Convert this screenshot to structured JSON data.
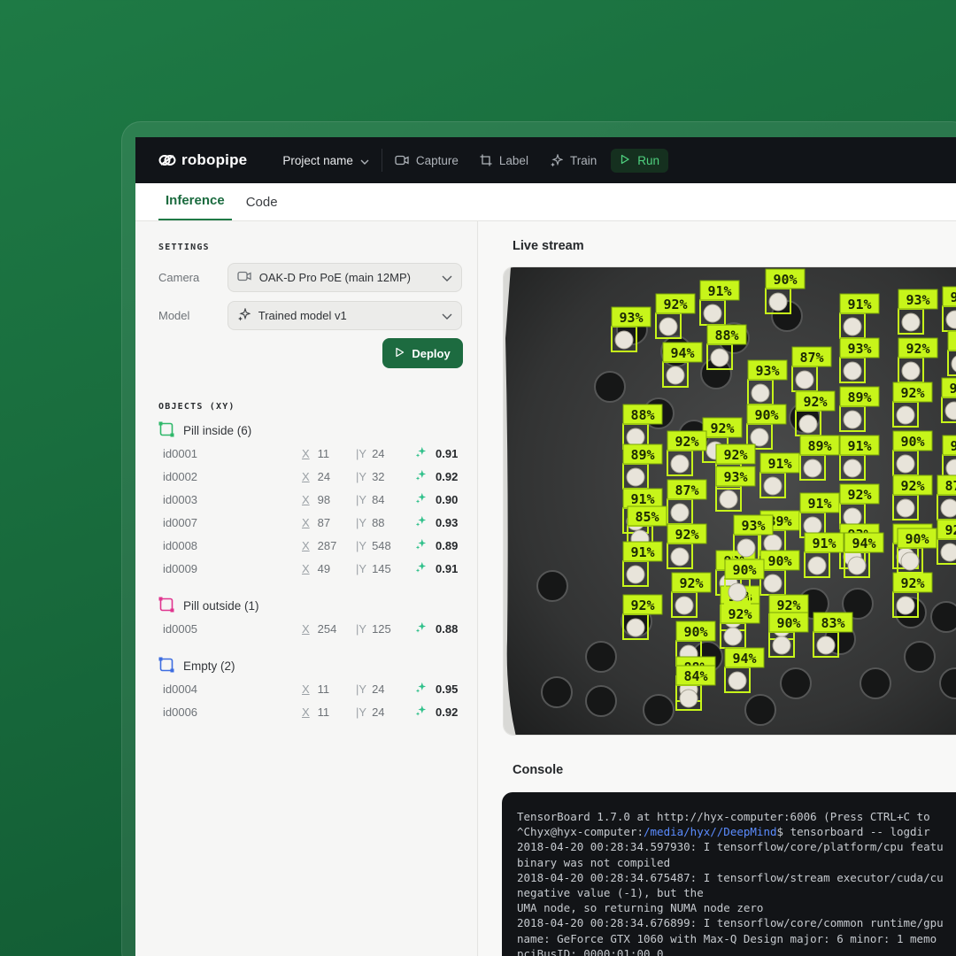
{
  "app": {
    "brand": "robopipe",
    "project": "Project name",
    "nav": [
      {
        "label": "Capture",
        "icon": "video-icon"
      },
      {
        "label": "Label",
        "icon": "crop-icon"
      },
      {
        "label": "Train",
        "icon": "sparkle-icon"
      },
      {
        "label": "Run",
        "icon": "play-icon",
        "active": true
      }
    ]
  },
  "tabs": [
    {
      "label": "Inference",
      "active": true
    },
    {
      "label": "Code",
      "active": false
    }
  ],
  "settings": {
    "title": "SETTINGS",
    "camera_label": "Camera",
    "camera_value": "OAK-D Pro PoE (main 12MP)",
    "model_label": "Model",
    "model_value": "Trained model v1",
    "deploy_label": "Deploy"
  },
  "objects": {
    "title": "OBJECTS (XY)",
    "x_label": "X",
    "y_label": "Y",
    "groups": [
      {
        "name": "Pill inside (6)",
        "color": "#2fb86a",
        "items": [
          {
            "id": "id0001",
            "x": "11",
            "y": "24",
            "conf": "0.91"
          },
          {
            "id": "id0002",
            "x": "24",
            "y": "32",
            "conf": "0.92"
          },
          {
            "id": "id0003",
            "x": "98",
            "y": "84",
            "conf": "0.90"
          },
          {
            "id": "id0007",
            "x": "87",
            "y": "88",
            "conf": "0.93"
          },
          {
            "id": "id0008",
            "x": "287",
            "y": "548",
            "conf": "0.89"
          },
          {
            "id": "id0009",
            "x": "49",
            "y": "145",
            "conf": "0.91"
          }
        ]
      },
      {
        "name": "Pill outside (1)",
        "color": "#e0358f",
        "items": [
          {
            "id": "id0005",
            "x": "254",
            "y": "125",
            "conf": "0.88"
          }
        ]
      },
      {
        "name": "Empty (2)",
        "color": "#3d6de0",
        "items": [
          {
            "id": "id0004",
            "x": "11",
            "y": "24",
            "conf": "0.95"
          },
          {
            "id": "id0006",
            "x": "11",
            "y": "24",
            "conf": "0.92"
          }
        ]
      }
    ]
  },
  "live": {
    "title": "Live stream",
    "detections": [
      "90%",
      "91%",
      "92%",
      "93%",
      "88%",
      "94%",
      "91%",
      "93%",
      "91%",
      "93%",
      "92%",
      "93%",
      "87%",
      "93%",
      "90%",
      "92%",
      "89%",
      "92%",
      "90%",
      "92%",
      "88%",
      "92%",
      "89%",
      "92%",
      "91%",
      "89%",
      "91%",
      "90%",
      "92%",
      "91%",
      "87%",
      "93%",
      "89%",
      "91%",
      "92%",
      "92%",
      "87%",
      "89%",
      "93%",
      "85%",
      "92%",
      "92%",
      "90%",
      "91%",
      "94%",
      "92%",
      "92%",
      "91%",
      "92%",
      "90%",
      "92%",
      "90%",
      "92%",
      "83%",
      "90%",
      "93%",
      "92%",
      "94%",
      "90%",
      "88%",
      "90%",
      "84%"
    ]
  },
  "console": {
    "title": "Console",
    "lines": [
      {
        "text": "TensorBoard 1.7.0 at http://hyx-computer:6006 (Press CTRL+C to"
      },
      {
        "prefix": "^Chyx@hyx-computer:",
        "path": "/media/hyx//DeepMind",
        "text": "$ tensorboard -- logdir"
      },
      {
        "text": "2018-04-20 00:28:34.597930: I tensorflow/core/platform/cpu featu"
      },
      {
        "text": "binary was not compiled"
      },
      {
        "text": "2018-04-20 00:28:34.675487: I tensorflow/stream executor/cuda/cu"
      },
      {
        "text": "negative value (-1), but the"
      },
      {
        "text": "UMA node, so returning NUMA node zero"
      },
      {
        "text": "2018-04-20 00:28:34.676899: I tensorflow/core/common runtime/gpu"
      },
      {
        "text": "name: GeForce GTX 1060 with Max-Q Design major: 6 minor: 1 memo"
      },
      {
        "text": "pciBusID: 0000:01:00.0"
      }
    ]
  }
}
